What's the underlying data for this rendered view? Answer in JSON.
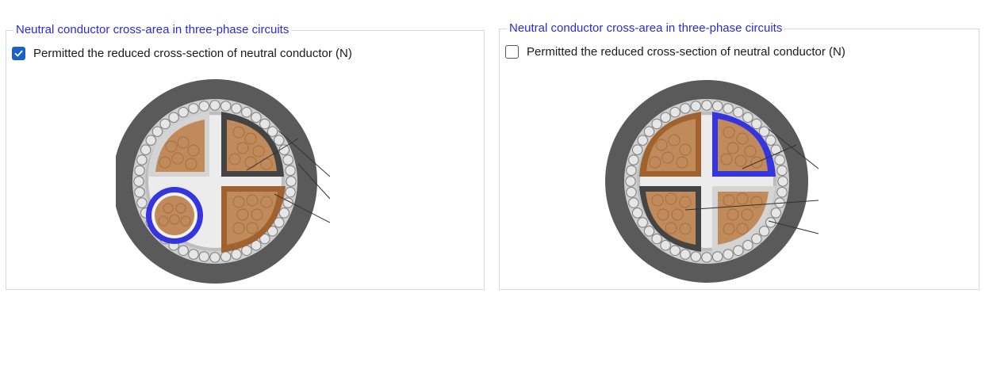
{
  "panels": [
    {
      "legend": "Neutral conductor cross-area in three-phase circuits",
      "checkbox": {
        "label": "Permitted the reduced cross-section of neutral conductor (N)",
        "checked": true
      }
    },
    {
      "legend": "Neutral conductor cross-area in three-phase circuits",
      "checkbox": {
        "label": "Permitted the reduced cross-section of neutral conductor (N)",
        "checked": false
      }
    }
  ],
  "colors": {
    "legend_text": "#2b2bd6",
    "checkbox_checked": "#1a62c9",
    "neutral_highlight": "#3535e0",
    "copper": "#c08a5a",
    "sheath": "#555555"
  },
  "icons": [
    "checkbox-checked-icon",
    "checkbox-unchecked-icon",
    "cable-cross-section-reduced-neutral",
    "cable-cross-section-equal-neutral"
  ]
}
